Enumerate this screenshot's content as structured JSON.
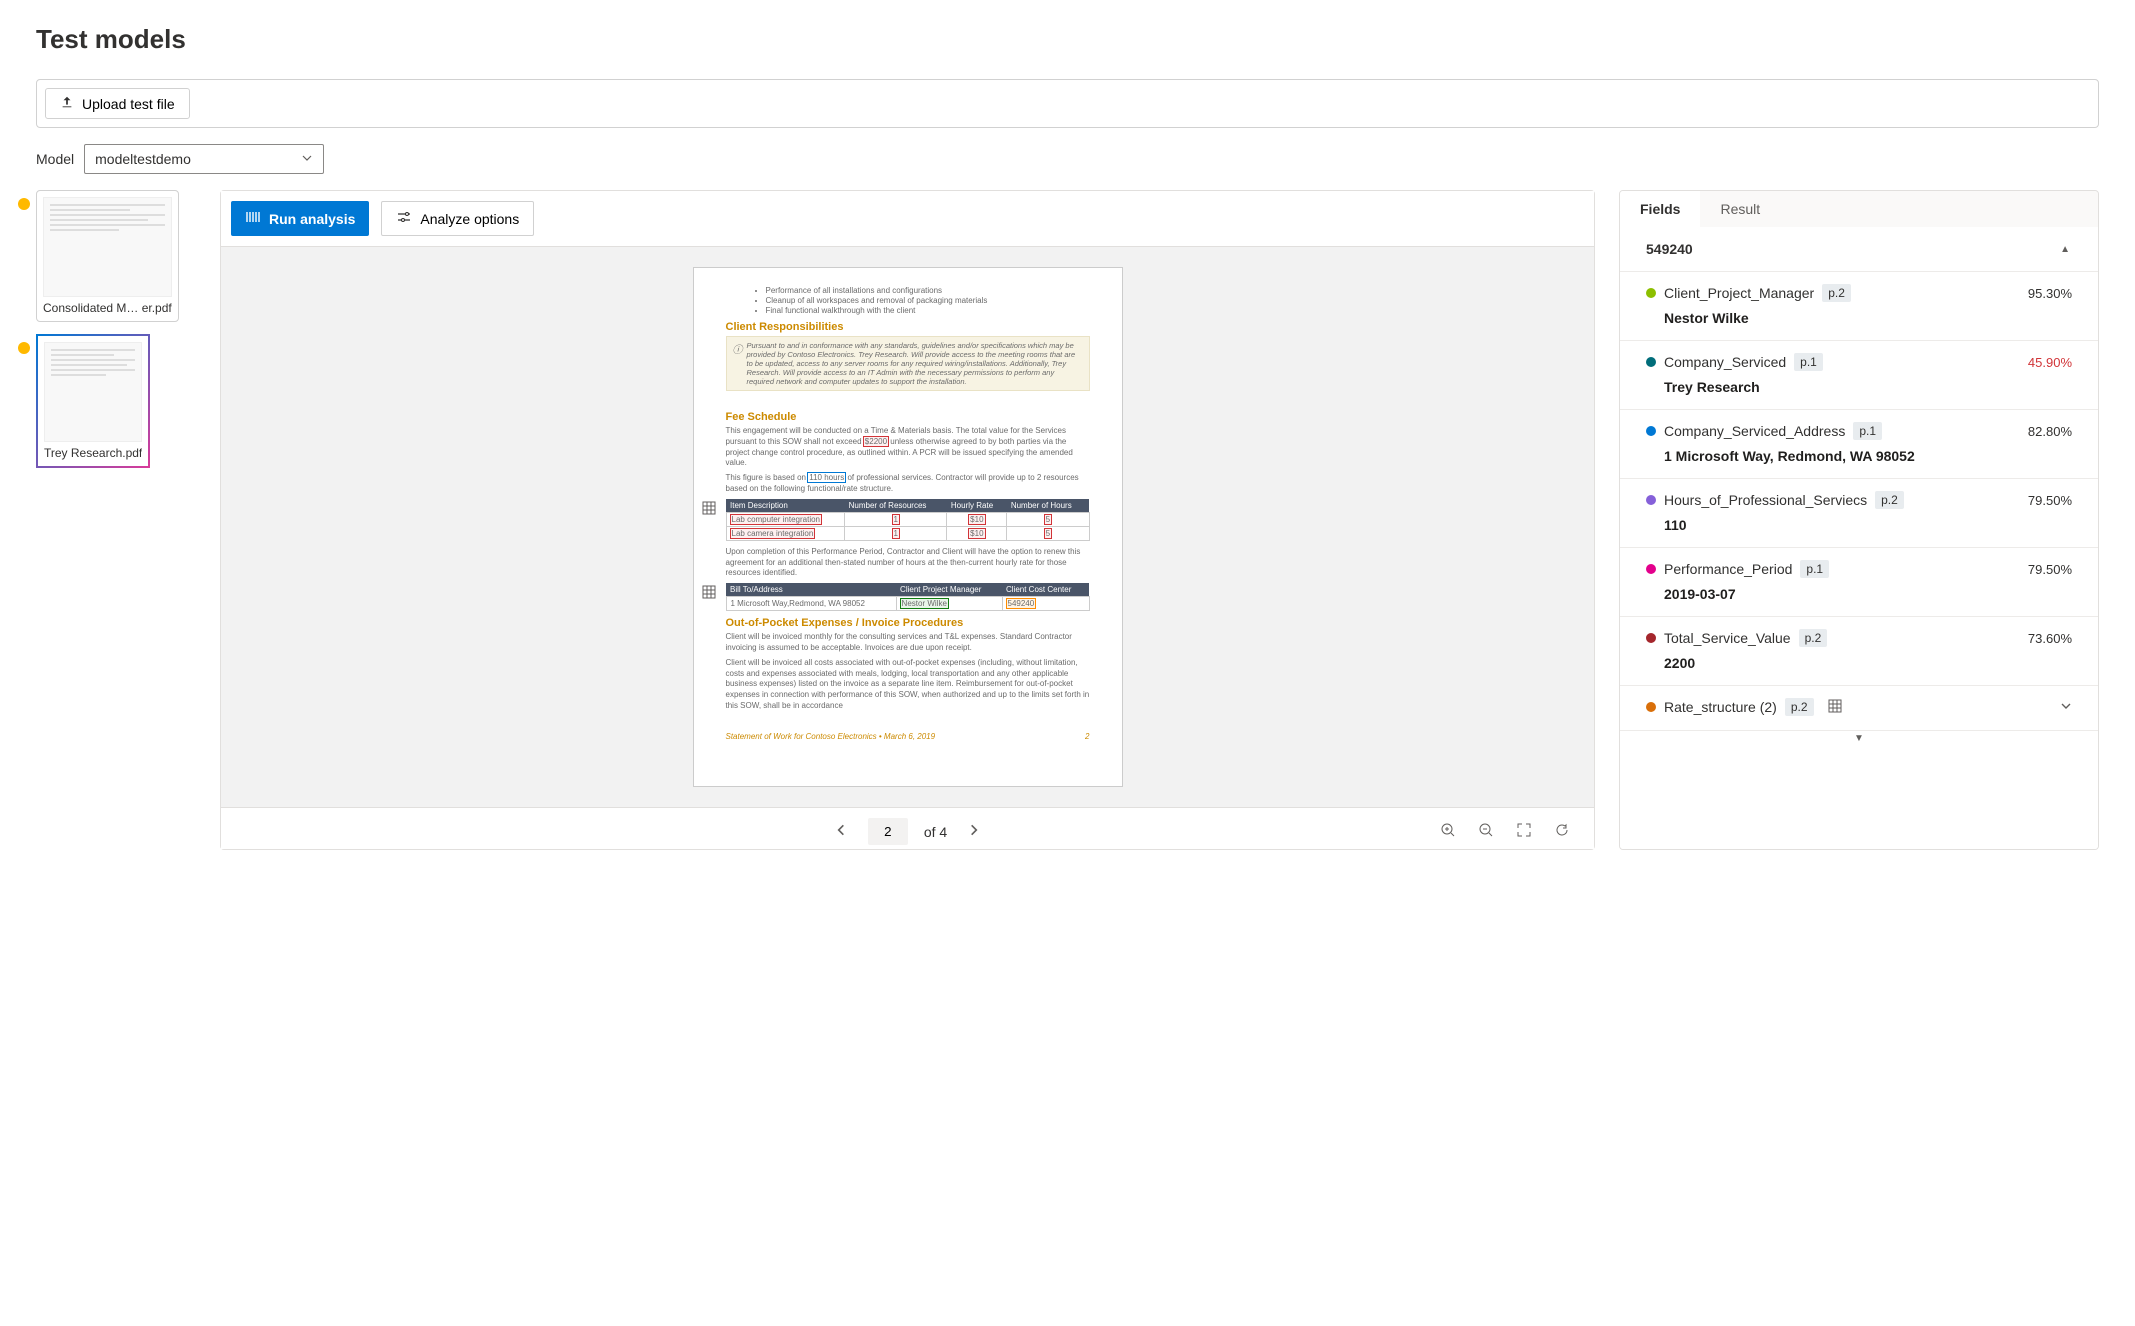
{
  "title": "Test models",
  "upload_label": "Upload test file",
  "model_label": "Model",
  "model_selected": "modeltestdemo",
  "thumbs": [
    {
      "name": "Consolidated M… er.pdf",
      "selected": false
    },
    {
      "name": "Trey Research.pdf",
      "selected": true
    }
  ],
  "run_label": "Run analysis",
  "options_label": "Analyze options",
  "pager": {
    "current": "2",
    "total_label": "of 4"
  },
  "tabs": {
    "fields": "Fields",
    "result": "Result"
  },
  "top_value": "549240",
  "fields": [
    {
      "color": "#8cbf00",
      "name": "Client_Project_Manager",
      "page": "p.2",
      "conf": "95.30%",
      "low": false,
      "value": "Nestor Wilke"
    },
    {
      "color": "#006d7a",
      "name": "Company_Serviced",
      "page": "p.1",
      "conf": "45.90%",
      "low": true,
      "value": "Trey Research"
    },
    {
      "color": "#0078d4",
      "name": "Company_Serviced_Address",
      "page": "p.1",
      "conf": "82.80%",
      "low": false,
      "value": "1 Microsoft Way, Redmond, WA 98052"
    },
    {
      "color": "#8560d9",
      "name": "Hours_of_Professional_Serviecs",
      "page": "p.2",
      "conf": "79.50%",
      "low": false,
      "value": "110"
    },
    {
      "color": "#e3008c",
      "name": "Performance_Period",
      "page": "p.1",
      "conf": "79.50%",
      "low": false,
      "value": "2019-03-07"
    },
    {
      "color": "#a4262c",
      "name": "Total_Service_Value",
      "page": "p.2",
      "conf": "73.60%",
      "low": false,
      "value": "2200"
    }
  ],
  "rate_field": {
    "color": "#d96f0a",
    "name": "Rate_structure (2)",
    "page": "p.2"
  },
  "doc": {
    "bullets": [
      "Performance of all installations and configurations",
      "Cleanup of all workspaces and removal of packaging materials",
      "Final functional walkthrough with the client"
    ],
    "h_client_resp": "Client Responsibilities",
    "note_client": "Pursuant to and in conformance with any standards, guidelines and/or specifications which may be provided by Contoso Electronics. Trey Research. Will provide access to the meeting rooms that are to be updated, access to any server rooms for any required wiring/installations. Additionally, Trey Research. Will provide access to an IT Admin with the necessary permissions to perform any required network and computer updates to support the installation.",
    "h_fee": "Fee Schedule",
    "fee_p1a": "This engagement will be conducted on a Time & Materials basis. The total value for the Services pursuant to this SOW shall not exceed ",
    "fee_total": "$2200",
    "fee_p1b": " unless otherwise agreed to by both parties via the project change control procedure, as outlined within. A PCR will be issued specifying the amended value.",
    "fee_p2a": "This figure is based on ",
    "fee_hours": "110 hours",
    "fee_p2b": " of professional services. Contractor will provide up to 2 resources based on the following functional/rate structure.",
    "rate_headers": [
      "Item Description",
      "Number of Resources",
      "Hourly Rate",
      "Number of Hours"
    ],
    "rate_rows": [
      [
        "Lab computer integration",
        "1",
        "$10",
        "5"
      ],
      [
        "Lab camera integration",
        "1",
        "$10",
        "5"
      ]
    ],
    "fee_p3": "Upon completion of this Performance Period, Contractor and Client will have the option to renew this agreement for an additional then-stated number of hours at the then-current hourly rate for those resources identified.",
    "bill_headers": [
      "Bill To/Address",
      "Client Project Manager",
      "Client Cost Center"
    ],
    "bill_row": [
      "1 Microsoft Way,Redmond, WA 98052",
      "Nestor Wilke",
      "549240"
    ],
    "h_oop": "Out-of-Pocket Expenses / Invoice Procedures",
    "oop1": "Client will be invoiced monthly for the consulting services and T&L expenses. Standard Contractor invoicing is assumed to be acceptable. Invoices are due upon receipt.",
    "oop2": "Client will be invoiced all costs associated with out-of-pocket expenses (including, without limitation, costs and expenses associated with meals, lodging, local transportation and any other applicable business expenses) listed on the invoice as a separate line item. Reimbursement for out-of-pocket expenses in connection with performance of this SOW, when authorized and up to the limits set forth in this SOW, shall be in accordance",
    "footer_left": "Statement of Work for Contoso Electronics • March 6, 2019",
    "footer_right": "2"
  }
}
